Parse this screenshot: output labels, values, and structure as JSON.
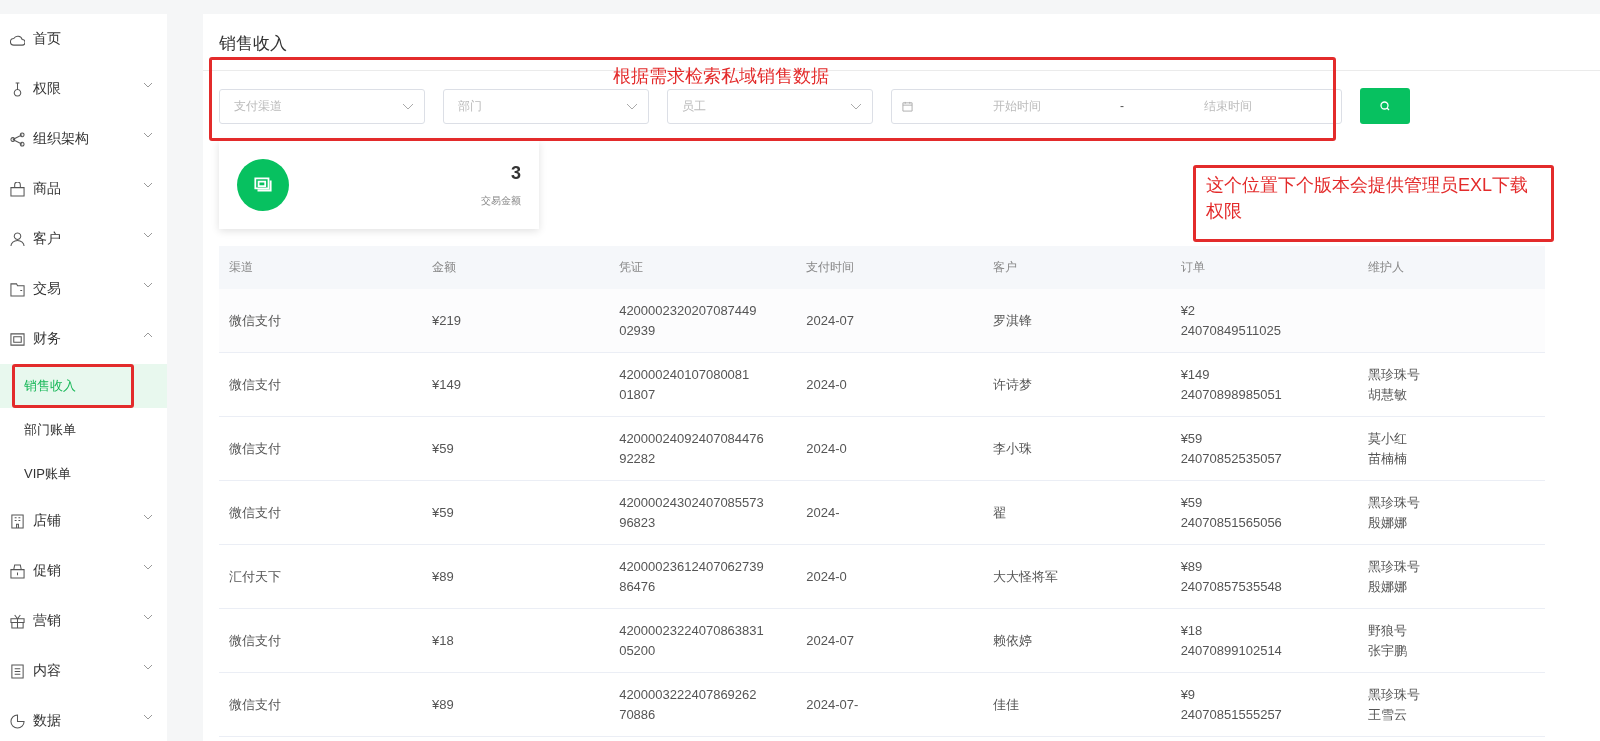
{
  "sidebar": {
    "items": [
      {
        "label": "首页",
        "kind": "link"
      },
      {
        "label": "权限",
        "kind": "group",
        "expanded": false
      },
      {
        "label": "组织架构",
        "kind": "group",
        "expanded": false
      },
      {
        "label": "商品",
        "kind": "group",
        "expanded": false
      },
      {
        "label": "客户",
        "kind": "group",
        "expanded": false
      },
      {
        "label": "交易",
        "kind": "group",
        "expanded": false
      },
      {
        "label": "财务",
        "kind": "group",
        "expanded": true,
        "children": [
          {
            "label": "销售收入",
            "selected": true,
            "highlighted": true
          },
          {
            "label": "部门账单",
            "selected": false,
            "highlighted": false
          },
          {
            "label": "VIP账单",
            "selected": false,
            "highlighted": false
          }
        ]
      },
      {
        "label": "店铺",
        "kind": "group",
        "expanded": false
      },
      {
        "label": "促销",
        "kind": "group",
        "expanded": false
      },
      {
        "label": "营销",
        "kind": "group",
        "expanded": false
      },
      {
        "label": "内容",
        "kind": "group",
        "expanded": false
      },
      {
        "label": "数据",
        "kind": "group",
        "expanded": false
      }
    ]
  },
  "page_title": "销售收入",
  "filters": {
    "selects": [
      {
        "placeholder": "支付渠道"
      },
      {
        "placeholder": "部门"
      },
      {
        "placeholder": "员工"
      }
    ],
    "date_range": {
      "start_placeholder": "开始时间",
      "separator": "-",
      "end_placeholder": "结束时间"
    }
  },
  "summary": {
    "value": "3",
    "label": "交易金额"
  },
  "table": {
    "columns": [
      "渠道",
      "金额",
      "凭证",
      "支付时间",
      "客户",
      "订单",
      "维护人"
    ],
    "rows": [
      {
        "channel": "微信支付",
        "amount": "¥219",
        "voucher": [
          "4200002320207087449",
          "02939"
        ],
        "time": "2024-07",
        "customer": "罗淇锋",
        "order": [
          "¥2",
          "24070849511025"
        ],
        "maintainer": []
      },
      {
        "channel": "微信支付",
        "amount": "¥149",
        "voucher": [
          "420000240107080081",
          "01807"
        ],
        "time": "2024-0",
        "customer": "许诗梦",
        "order": [
          "¥149",
          "24070898985051"
        ],
        "maintainer": [
          "黑珍珠号",
          "胡慧敏"
        ]
      },
      {
        "channel": "微信支付",
        "amount": "¥59",
        "voucher": [
          "42000024092407084476",
          "92282"
        ],
        "time": "2024-0",
        "customer": "李小珠",
        "order": [
          "¥59",
          "24070852535057"
        ],
        "maintainer": [
          "莫小红",
          "苗楠楠"
        ]
      },
      {
        "channel": "微信支付",
        "amount": "¥59",
        "voucher": [
          "42000024302407085573",
          "96823"
        ],
        "time": "2024-",
        "customer": "翟",
        "order": [
          "¥59",
          "24070851565056"
        ],
        "maintainer": [
          "黑珍珠号",
          "殷娜娜"
        ]
      },
      {
        "channel": "汇付天下",
        "amount": "¥89",
        "voucher": [
          "42000023612407062739",
          "86476"
        ],
        "time": "2024-0",
        "customer": "大大怪将军",
        "order": [
          "¥89",
          "24070857535548"
        ],
        "maintainer": [
          "黑珍珠号",
          "殷娜娜"
        ]
      },
      {
        "channel": "微信支付",
        "amount": "¥18",
        "voucher": [
          "42000023224070863831",
          "05200"
        ],
        "time": "2024-07",
        "customer": "赖依婷",
        "order": [
          "¥18",
          "24070899102514"
        ],
        "maintainer": [
          "野狼号",
          "张宇鹏"
        ]
      },
      {
        "channel": "微信支付",
        "amount": "¥89",
        "voucher": [
          "4200003222407869262",
          "70886"
        ],
        "time": "2024-07-",
        "customer": "佳佳",
        "order": [
          "¥9",
          "24070851555257"
        ],
        "maintainer": [
          "黑珍珠号",
          "王雪云"
        ]
      }
    ]
  },
  "annotations": [
    {
      "text": "根据需求检索私域销售数据"
    },
    {
      "text": "这个位置下个版本会提供管理员EXL下载权限"
    }
  ]
}
